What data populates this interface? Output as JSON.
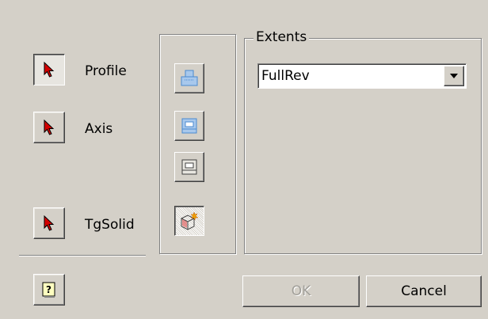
{
  "steps": {
    "profile_label": "Profile",
    "axis_label": "Axis",
    "tgsolid_label": "TgSolid"
  },
  "extents": {
    "legend": "Extents",
    "selected_value": "FullRev"
  },
  "buttons": {
    "ok_label": "OK",
    "cancel_label": "Cancel"
  },
  "icons": {
    "select": "cursor-arrow-icon",
    "help": "help-icon",
    "tool1": "extrude-add-icon",
    "tool2": "extrude-cut-icon",
    "tool3": "extrude-intersect-icon",
    "tool4": "new-body-icon"
  },
  "colors": {
    "dialog_bg": "#d4d0c8",
    "arrow_red": "#d40000",
    "icon_blue": "#4a8ad0"
  }
}
